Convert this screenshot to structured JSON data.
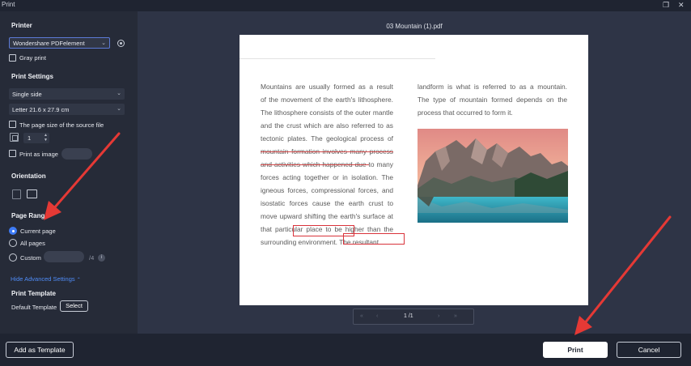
{
  "window": {
    "title": "Print",
    "restore_icon": "restore-icon",
    "close_icon": "close-icon"
  },
  "left": {
    "printer": {
      "heading": "Printer",
      "value": "Wondershare PDFelement",
      "gray_print": "Gray print"
    },
    "settings": {
      "heading": "Print Settings",
      "sides": "Single side",
      "paper": "Letter 21.6 x 27.9 cm",
      "source_size": "The page size of the source file",
      "copies": "1",
      "print_as_image": "Print as image"
    },
    "orientation": {
      "heading": "Orientation",
      "portrait_icon": "portrait-icon",
      "landscape_icon": "landscape-icon"
    },
    "page_range": {
      "heading": "Page Range",
      "current": "Current page",
      "all": "All pages",
      "custom": "Custom",
      "custom_total": "/4",
      "selected": "current"
    },
    "advanced_toggle": "Hide Advanced Settings",
    "template": {
      "heading": "Print Template",
      "label": "Default Template",
      "select_label": "Select"
    },
    "add_template": "Add as Template"
  },
  "preview": {
    "file_name": "03 Mountain (1).pdf",
    "page_indicator": "1 /1",
    "col1_lines": [
      "Mountains are usually formed as a result",
      "of the movement of the earth's lithosphere.",
      "The lithosphere consists of the outer mantle",
      "and the crust which are also referred to as",
      "tectonic plates. The geological process of",
      "mountain formation involves many process",
      "and activities which happened due to many",
      "forces acting together or in isolation. The",
      "igneous forces, compressional forces, and",
      "isostatic forces cause the earth crust to",
      "move upward shifting the earth's surface at",
      "that particular place to be higher than the",
      "surrounding environment. The resultant"
    ],
    "col2_lines": [
      "landform is what is referred to as a mountain.",
      "The type of mountain formed depends on the",
      "process that occurred to form it."
    ]
  },
  "actions": {
    "print": "Print",
    "cancel": "Cancel"
  },
  "colors": {
    "accent": "#3e7bf6",
    "annotation_red": "#e53935"
  }
}
